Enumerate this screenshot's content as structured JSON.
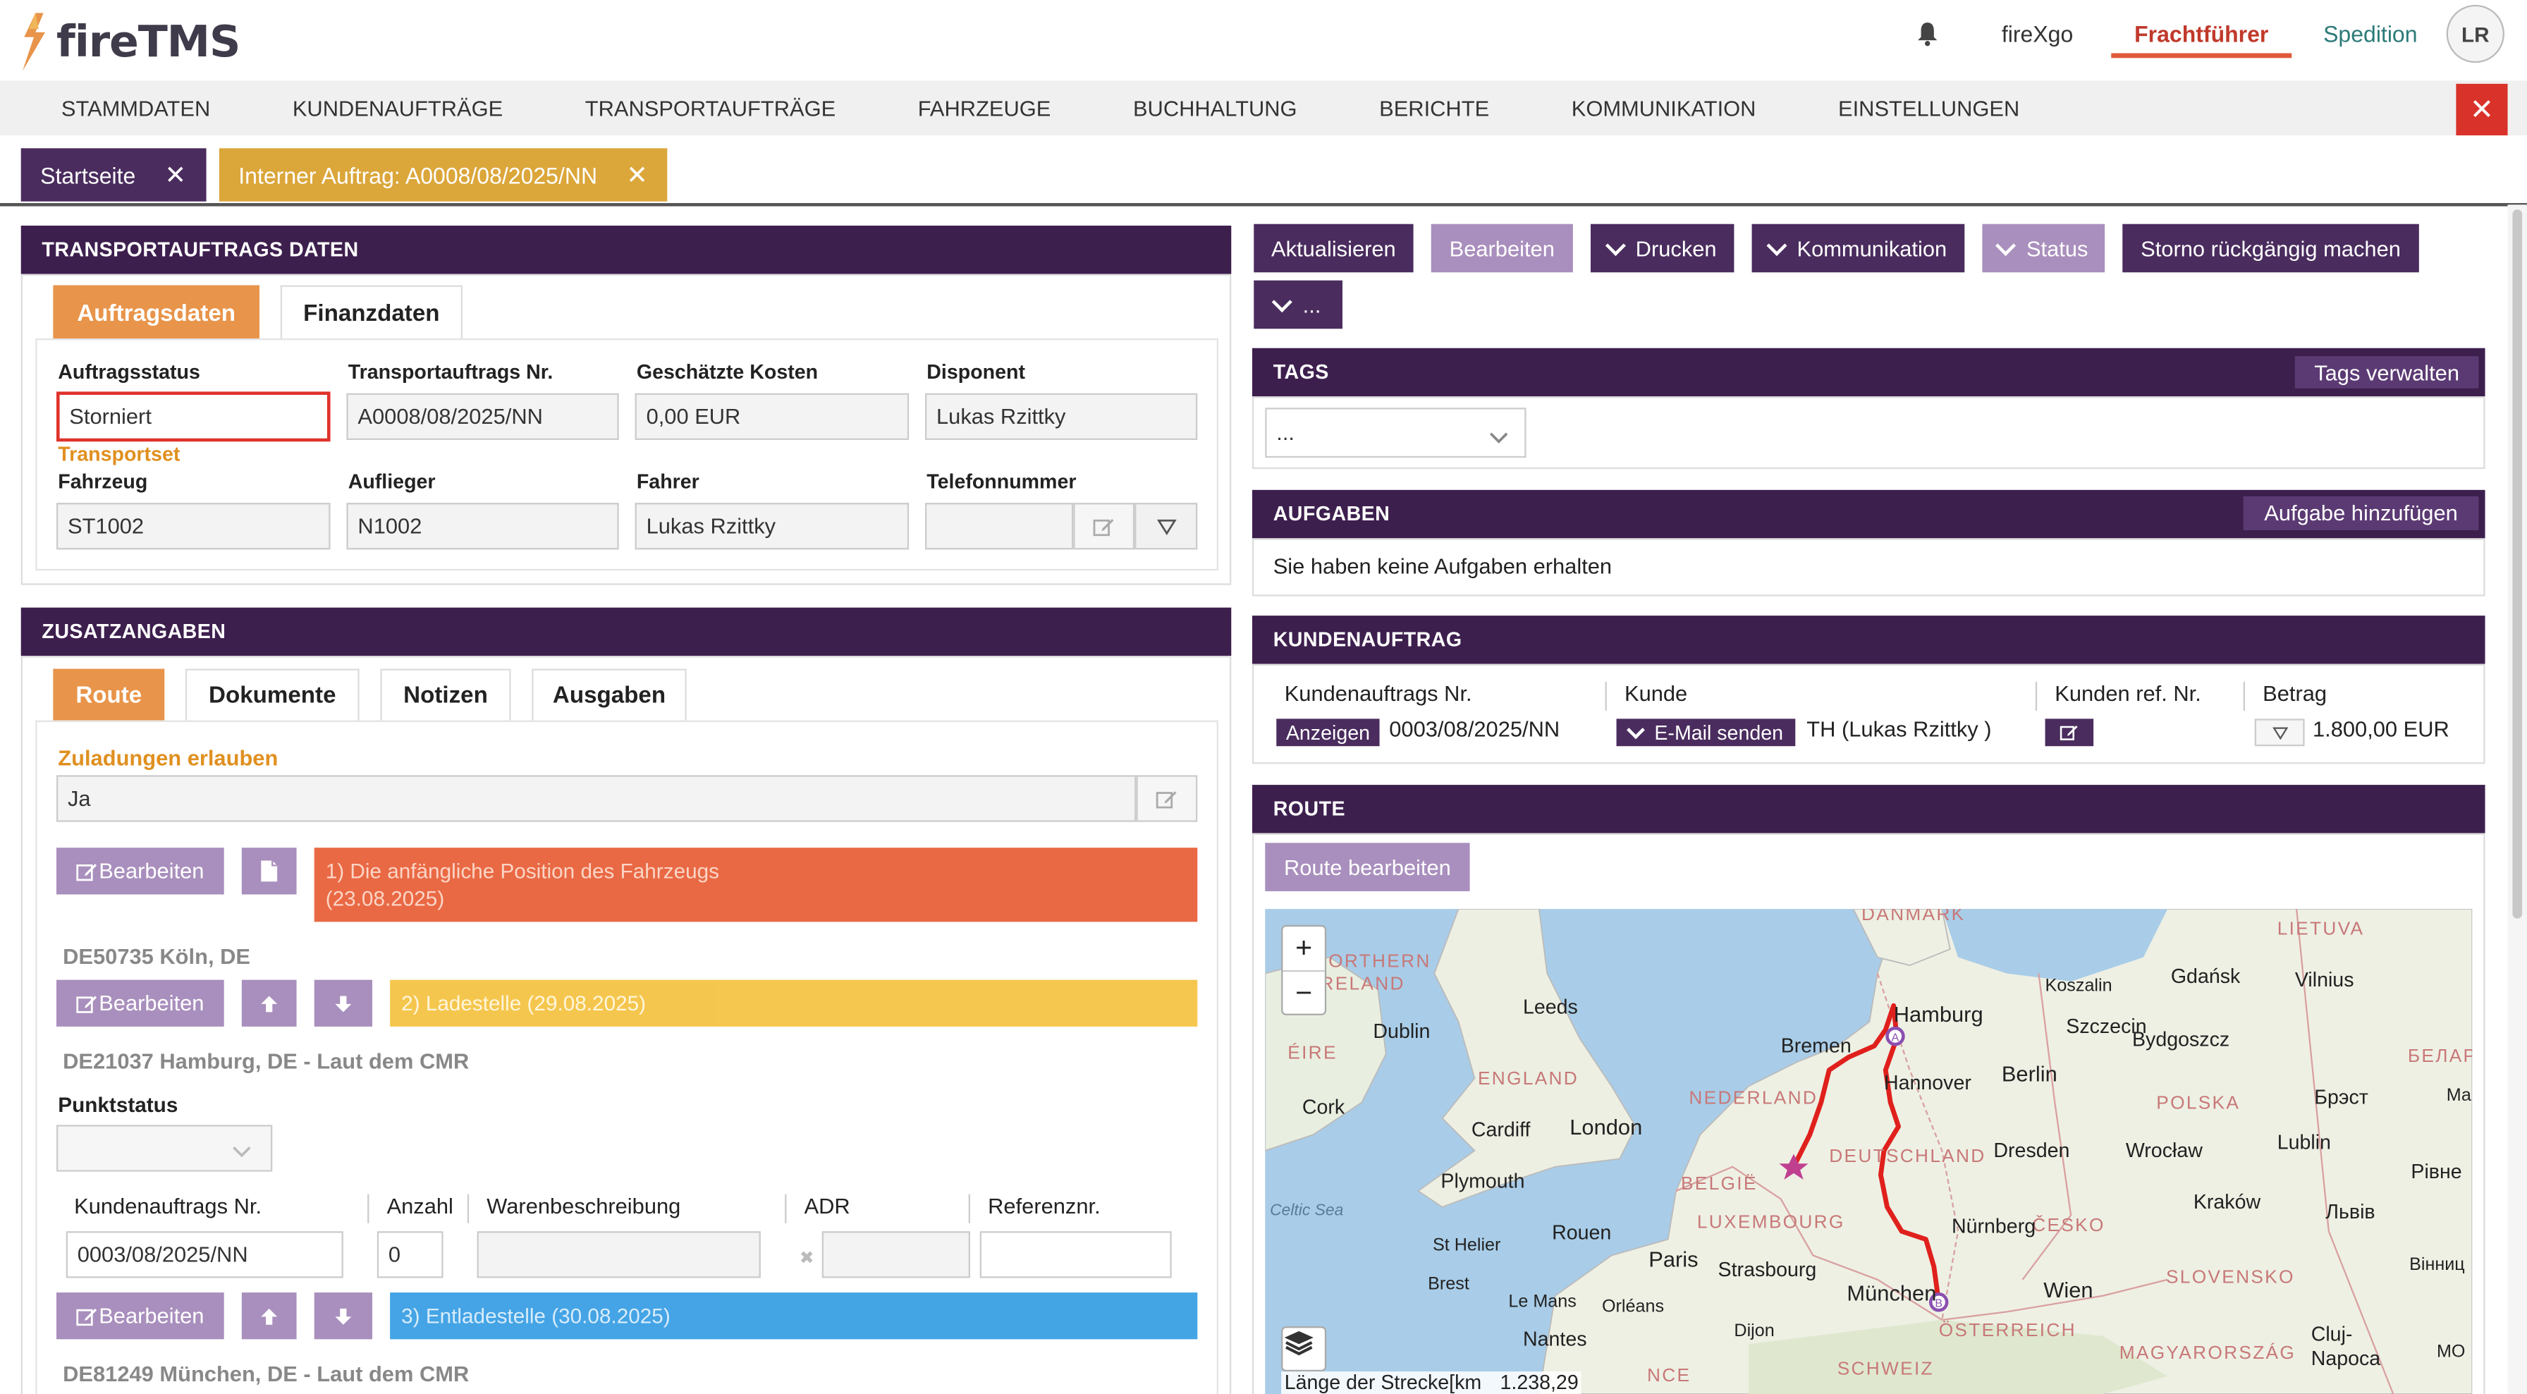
{
  "app": {
    "logo_text": "fireTMS"
  },
  "header": {
    "links": [
      "fireXgo",
      "Frachtführer",
      "Spedition"
    ],
    "avatar": "LR",
    "icons": {
      "bell": "bell-icon"
    }
  },
  "nav": {
    "items": [
      "STAMMDATEN",
      "KUNDENAUFTRÄGE",
      "TRANSPORTAUFTRÄGE",
      "FAHRZEUGE",
      "BUCHHALTUNG",
      "BERICHTE",
      "KOMMUNIKATION",
      "EINSTELLUNGEN"
    ],
    "close": "✕"
  },
  "page_tabs": [
    {
      "label": "Startseite",
      "close": "✕"
    },
    {
      "label": "Interner Auftrag: A0008/08/2025/NN",
      "close": "✕"
    }
  ],
  "transport": {
    "title": "TRANSPORTAUFTRAGS DATEN",
    "tabs": [
      "Auftragsdaten",
      "Finanzdaten"
    ],
    "labels": {
      "status": "Auftragsstatus",
      "nr": "Transportauftrags Nr.",
      "cost": "Geschätzte Kosten",
      "dispo": "Disponent",
      "transportset": "Transportset",
      "vehicle": "Fahrzeug",
      "trailer": "Auflieger",
      "driver": "Fahrer",
      "phone": "Telefonnummer"
    },
    "values": {
      "status": "Storniert",
      "nr": "A0008/08/2025/NN",
      "cost": "0,00 EUR",
      "dispo": "Lukas Rzittky",
      "vehicle": "ST1002",
      "trailer": "N1002",
      "driver": "Lukas Rzittky",
      "phone": ""
    }
  },
  "extra": {
    "title": "ZUSATZANGABEN",
    "tabs": [
      "Route",
      "Dokumente",
      "Notizen",
      "Ausgaben"
    ],
    "allow_label": "Zuladungen erlauben",
    "allow_value": "Ja",
    "edit_label": "Bearbeiten",
    "stops": [
      {
        "label": "1) Die anfängliche Position des Fahrzeugs",
        "date": "(23.08.2025)",
        "address": "DE50735 Köln, DE"
      },
      {
        "label": "2) Ladestelle (29.08.2025)",
        "address": "DE21037 Hamburg, DE - Laut dem CMR"
      },
      {
        "label": "3) Entladestelle (30.08.2025)",
        "address": "DE81249 München, DE - Laut dem CMR"
      }
    ],
    "point_status_label": "Punktstatus",
    "cargo_headers": [
      "Kundenauftrags Nr.",
      "Anzahl",
      "Warenbeschreibung",
      "ADR",
      "Referenznr."
    ],
    "cargo_row": {
      "order": "0003/08/2025/NN",
      "count": "0",
      "desc": "",
      "adr": "",
      "ref": ""
    }
  },
  "actions": {
    "buttons": [
      "Aktualisieren",
      "Bearbeiten",
      "Drucken",
      "Kommunikation",
      "Status",
      "Storno rückgängig machen",
      "..."
    ]
  },
  "tags": {
    "title": "TAGS",
    "manage": "Tags verwalten",
    "select": "..."
  },
  "tasks": {
    "title": "AUFGABEN",
    "add": "Aufgabe hinzufügen",
    "empty": "Sie haben keine Aufgaben erhalten"
  },
  "customer": {
    "title": "KUNDENAUFTRAG",
    "headers": [
      "Kundenauftrags Nr.",
      "Kunde",
      "Kunden ref. Nr.",
      "Betrag"
    ],
    "show": "Anzeigen",
    "order": "0003/08/2025/NN",
    "email": "E-Mail senden",
    "customer": "TH (Lukas Rzittky )",
    "amount": "1.800,00 EUR"
  },
  "route": {
    "title": "ROUTE",
    "edit": "Route bearbeiten",
    "distance_label": "Länge der Strecke[km",
    "distance_value": "1.238,29",
    "map_labels": {
      "danmark": "DANMARK",
      "lietuva": "LIETUVA",
      "northern_ireland": "NORTHERN IRELAND",
      "eire": "ÉIRE",
      "england": "ENGLAND",
      "nederland": "NEDERLAND",
      "deutschland": "DEUTSCHLAND",
      "belgie": "BELGIË",
      "luxembourg": "LUXEMBOURG",
      "cesko": "ČESKO",
      "polska": "POLSKA",
      "slovensko": "SLOVENSKO",
      "osterreich": "ÖSTERREICH",
      "magyarorszag": "MAGYARORSZÁG",
      "schweiz": "SCHWEIZ",
      "france": "NCE",
      "belarus": "БЕЛАР",
      "celtic": "Celtic Sea",
      "hamburg": "Hamburg",
      "bremen": "Bremen",
      "hannover": "Hannover",
      "berlin": "Berlin",
      "szczecin": "Szczecin",
      "koszalin": "Koszalin",
      "gdansk": "Gdańsk",
      "vilnius": "Vilnius",
      "bydgoszcz": "Bydgoszcz",
      "dublin": "Dublin",
      "leeds": "Leeds",
      "cork": "Cork",
      "london": "London",
      "cardiff": "Cardiff",
      "plymouth": "Plymouth",
      "dresden": "Dresden",
      "wroclaw": "Wrocław",
      "lublin": "Lublin",
      "brest_by": "Брэст",
      "rivne": "Рівне",
      "krakow": "Kraków",
      "lviv": "Львів",
      "nurnberg": "Nürnberg",
      "strasbourg": "Strasbourg",
      "paris": "Paris",
      "rouen": "Rouen",
      "sthelier": "St Helier",
      "brest": "Brest",
      "lemans": "Le Mans",
      "orleans": "Orléans",
      "nantes": "Nantes",
      "dijon": "Dijon",
      "munchen": "München",
      "wien": "Wien",
      "cluj": "Cluj-Napoca",
      "vinnytsia": "Вінниц",
      "ma": "Ма",
      "mo": "MO"
    }
  },
  "colors": {
    "purple": "#3d1f4e",
    "accent": "#e05a3a",
    "orange": "#e8944a",
    "yellow": "#dba63a",
    "blue": "#3aa0e4",
    "route": "#e0201c"
  }
}
